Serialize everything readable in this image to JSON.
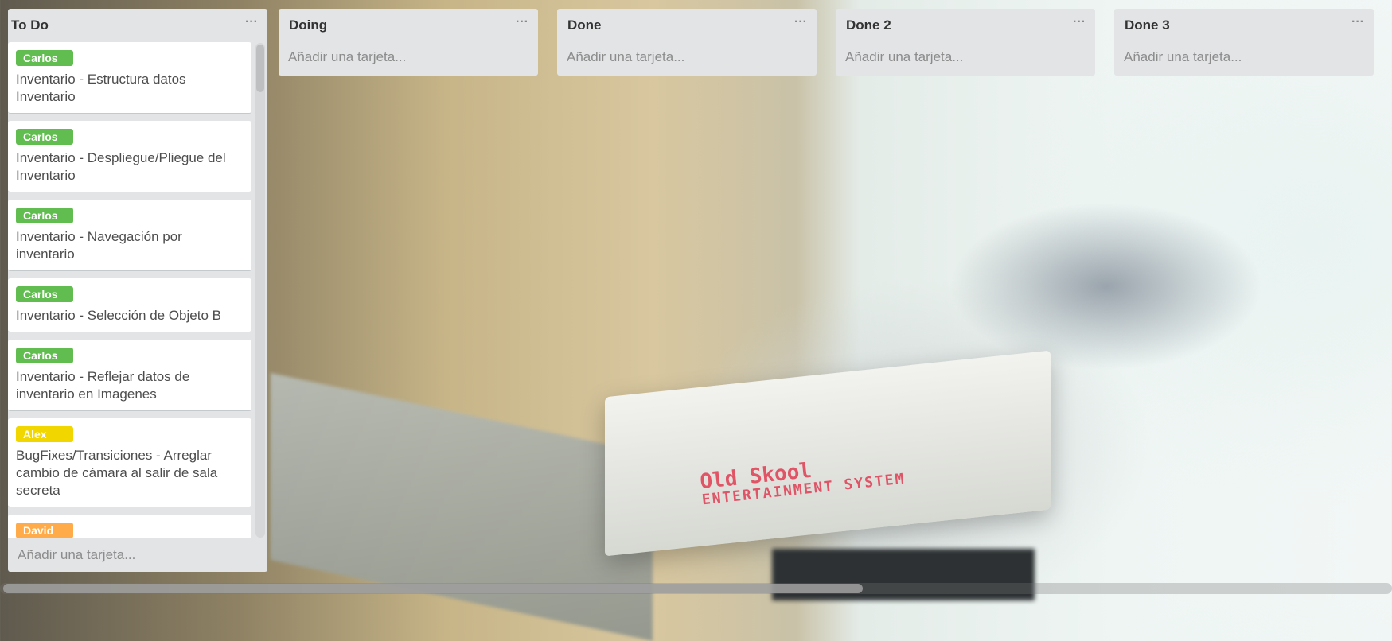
{
  "board": {
    "lists": [
      {
        "title": "To Do",
        "menu_icon": "ellipsis-icon",
        "menu_glyph": "···",
        "add_card": "Añadir una tarjeta...",
        "cards": [
          {
            "label": "Carlos",
            "label_color": "#61bd4f",
            "text": "Inventario - Estructura datos Inventario"
          },
          {
            "label": "Carlos",
            "label_color": "#61bd4f",
            "text": "Inventario - Despliegue/Pliegue del Inventario"
          },
          {
            "label": "Carlos",
            "label_color": "#61bd4f",
            "text": "Inventario - Navegación por inventario"
          },
          {
            "label": "Carlos",
            "label_color": "#61bd4f",
            "text": "Inventario - Selección de Objeto B"
          },
          {
            "label": "Carlos",
            "label_color": "#61bd4f",
            "text": "Inventario - Reflejar datos de inventario en Imagenes"
          },
          {
            "label": "Alex",
            "label_color": "#f2d600",
            "text": "BugFixes/Transiciones - Arreglar cambio de cámara al salir de sala secreta"
          },
          {
            "label": "David",
            "label_color": "#ffab4a",
            "text": ""
          }
        ]
      },
      {
        "title": "Doing",
        "menu_icon": "ellipsis-icon",
        "menu_glyph": "···",
        "add_card": "Añadir una tarjeta..."
      },
      {
        "title": "Done",
        "menu_icon": "ellipsis-icon",
        "menu_glyph": "···",
        "add_card": "Añadir una tarjeta..."
      },
      {
        "title": "Done 2",
        "menu_icon": "ellipsis-icon",
        "menu_glyph": "···",
        "add_card": "Añadir una tarjeta..."
      },
      {
        "title": "Done 3",
        "menu_icon": "ellipsis-icon",
        "menu_glyph": "···",
        "add_card": "Añadir una tarjeta..."
      }
    ]
  },
  "background": {
    "sign_line1": "Old Skool",
    "sign_line2": "ENTERTAINMENT SYSTEM"
  }
}
